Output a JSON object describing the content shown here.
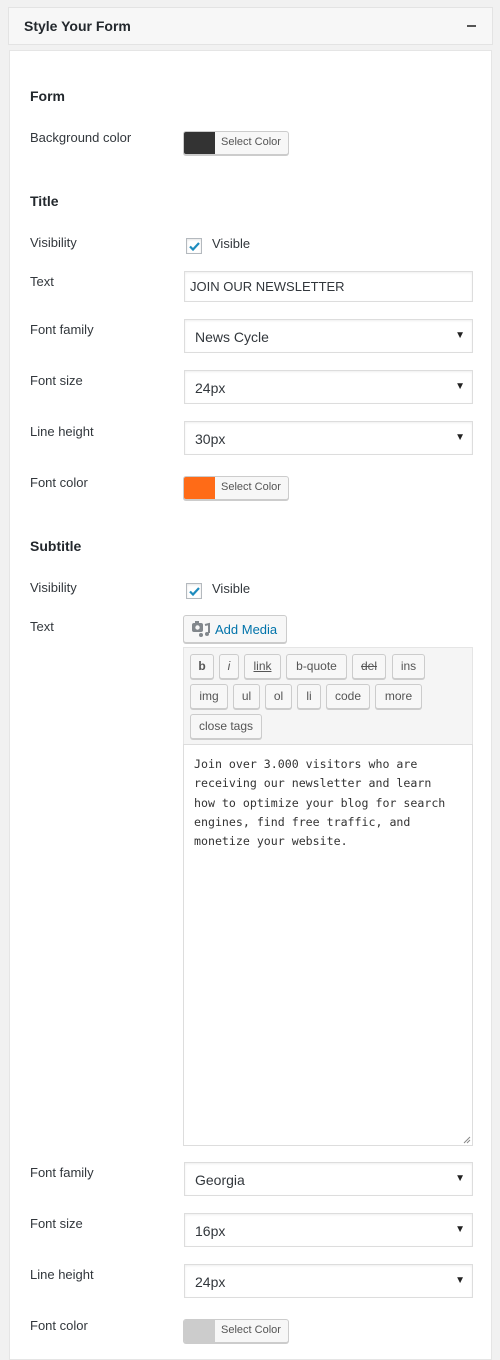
{
  "panel": {
    "title": "Style Your Form",
    "collapse_icon": "minus-icon"
  },
  "form_section": {
    "heading": "Form",
    "background_color": {
      "label": "Background color",
      "button_label": "Select Color",
      "color": "#333333"
    }
  },
  "title_section": {
    "heading": "Title",
    "visibility": {
      "label": "Visibility",
      "checked": true,
      "checkbox_label": "Visible"
    },
    "text": {
      "label": "Text",
      "value": "JOIN OUR NEWSLETTER"
    },
    "font_family": {
      "label": "Font family",
      "value": "News Cycle"
    },
    "font_size": {
      "label": "Font size",
      "value": "24px"
    },
    "line_height": {
      "label": "Line height",
      "value": "30px"
    },
    "font_color": {
      "label": "Font color",
      "button_label": "Select Color",
      "color": "#ff6b17"
    }
  },
  "subtitle_section": {
    "heading": "Subtitle",
    "visibility": {
      "label": "Visibility",
      "checked": true,
      "checkbox_label": "Visible"
    },
    "text": {
      "label": "Text",
      "add_media_label": "Add Media",
      "quicktags": [
        "b",
        "i",
        "link",
        "b-quote",
        "del",
        "ins",
        "img",
        "ul",
        "ol",
        "li",
        "code",
        "more",
        "close tags"
      ],
      "value": "Join over 3.000 visitors who are\nreceiving our newsletter and learn\nhow to optimize your blog for search\nengines, find free traffic, and\nmonetize your website."
    },
    "font_family": {
      "label": "Font family",
      "value": "Georgia"
    },
    "font_size": {
      "label": "Font size",
      "value": "16px"
    },
    "line_height": {
      "label": "Line height",
      "value": "24px"
    },
    "font_color": {
      "label": "Font color",
      "button_label": "Select Color",
      "color": "#cccccc"
    }
  },
  "icons": {
    "dropdown_arrow": "▼"
  }
}
